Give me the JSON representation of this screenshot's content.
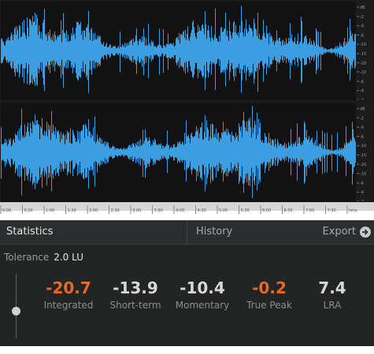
{
  "waveform": {
    "color": "#3a9ee0",
    "db_labels": [
      "dB",
      "-2",
      "-4",
      "-6",
      "-10",
      "-15",
      "-20",
      "-10",
      "-6",
      "-4",
      "-2"
    ],
    "time_labels": [
      "0:00",
      "0:30",
      "1:00",
      "1:30",
      "2:00",
      "2:30",
      "3:00",
      "3:30",
      "4:00",
      "4:30",
      "5:00",
      "5:30",
      "6:00",
      "6:30",
      "7:00",
      "7:30",
      "hms"
    ]
  },
  "tabs": {
    "statistics": "Statistics",
    "history": "History",
    "export": "Export"
  },
  "tolerance": {
    "label": "Tolerance",
    "value": "2.0 LU"
  },
  "metrics": [
    {
      "value": "-20.7",
      "label": "Integrated",
      "warn": true
    },
    {
      "value": "-13.9",
      "label": "Short-term",
      "warn": false
    },
    {
      "value": "-10.4",
      "label": "Momentary",
      "warn": false
    },
    {
      "value": "-0.2",
      "label": "True Peak",
      "warn": true
    },
    {
      "value": "7.4",
      "label": "LRA",
      "warn": false
    }
  ],
  "colors": {
    "warn": "#e8682a",
    "background": "#232525"
  }
}
